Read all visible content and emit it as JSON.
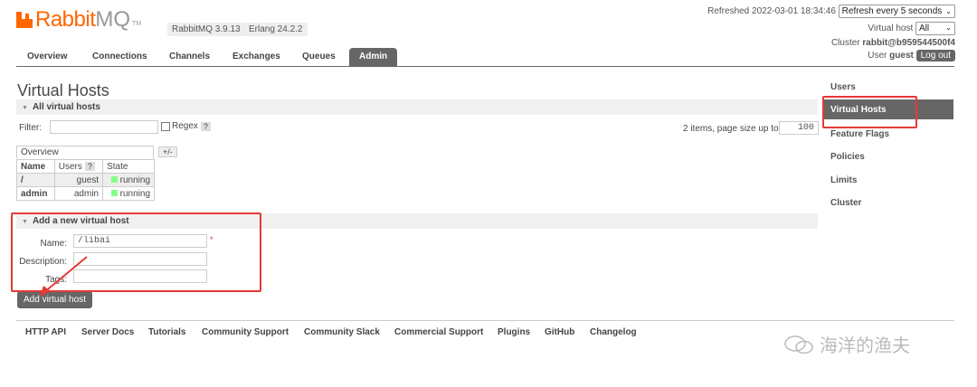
{
  "header": {
    "brand_rabbit": "Rabbit",
    "brand_mq": "MQ",
    "brand_tm": "TM",
    "rabbitmq_version": "RabbitMQ 3.9.13",
    "erlang_version": "Erlang 24.2.2",
    "refreshed": "Refreshed 2022-03-01 18:34:46",
    "refresh_select": "Refresh every 5 seconds",
    "vhost_label": "Virtual host",
    "vhost_select": "All",
    "cluster_label": "Cluster",
    "cluster_name": "rabbit@b959544500f4",
    "user_label": "User",
    "user_name": "guest",
    "logout": "Log out"
  },
  "nav": {
    "tabs": [
      "Overview",
      "Connections",
      "Channels",
      "Exchanges",
      "Queues",
      "Admin"
    ],
    "active": "Admin"
  },
  "main": {
    "title": "Virtual Hosts",
    "all_section": "All virtual hosts",
    "filter_label": "Filter:",
    "filter_value": "",
    "regex_label": "Regex",
    "help": "?",
    "paging_text": "2 items, page size up to",
    "page_size": "100",
    "overview_label": "Overview",
    "plus_minus": "+/-",
    "columns": [
      "Name",
      "Users",
      "State"
    ],
    "rows": [
      {
        "name": "/",
        "users": "guest",
        "state": "running"
      },
      {
        "name": "admin",
        "users": "admin",
        "state": "running"
      }
    ],
    "add_section": "Add a new virtual host",
    "name_label": "Name:",
    "name_value": "/libai",
    "required_mark": "*",
    "description_label": "Description:",
    "description_value": "",
    "tags_label": "Tags:",
    "tags_value": "",
    "add_button": "Add virtual host"
  },
  "sidebar": {
    "items": [
      "Users",
      "Virtual Hosts",
      "Feature Flags",
      "Policies",
      "Limits",
      "Cluster"
    ],
    "active": "Virtual Hosts"
  },
  "footer": {
    "links": [
      "HTTP API",
      "Server Docs",
      "Tutorials",
      "Community Support",
      "Community Slack",
      "Commercial Support",
      "Plugins",
      "GitHub",
      "Changelog"
    ]
  },
  "watermark": "海洋的渔夫",
  "colors": {
    "brand_orange": "#ff6600",
    "active_tab": "#666666",
    "highlight_red": "#e53935",
    "running_green": "#88ff88"
  }
}
